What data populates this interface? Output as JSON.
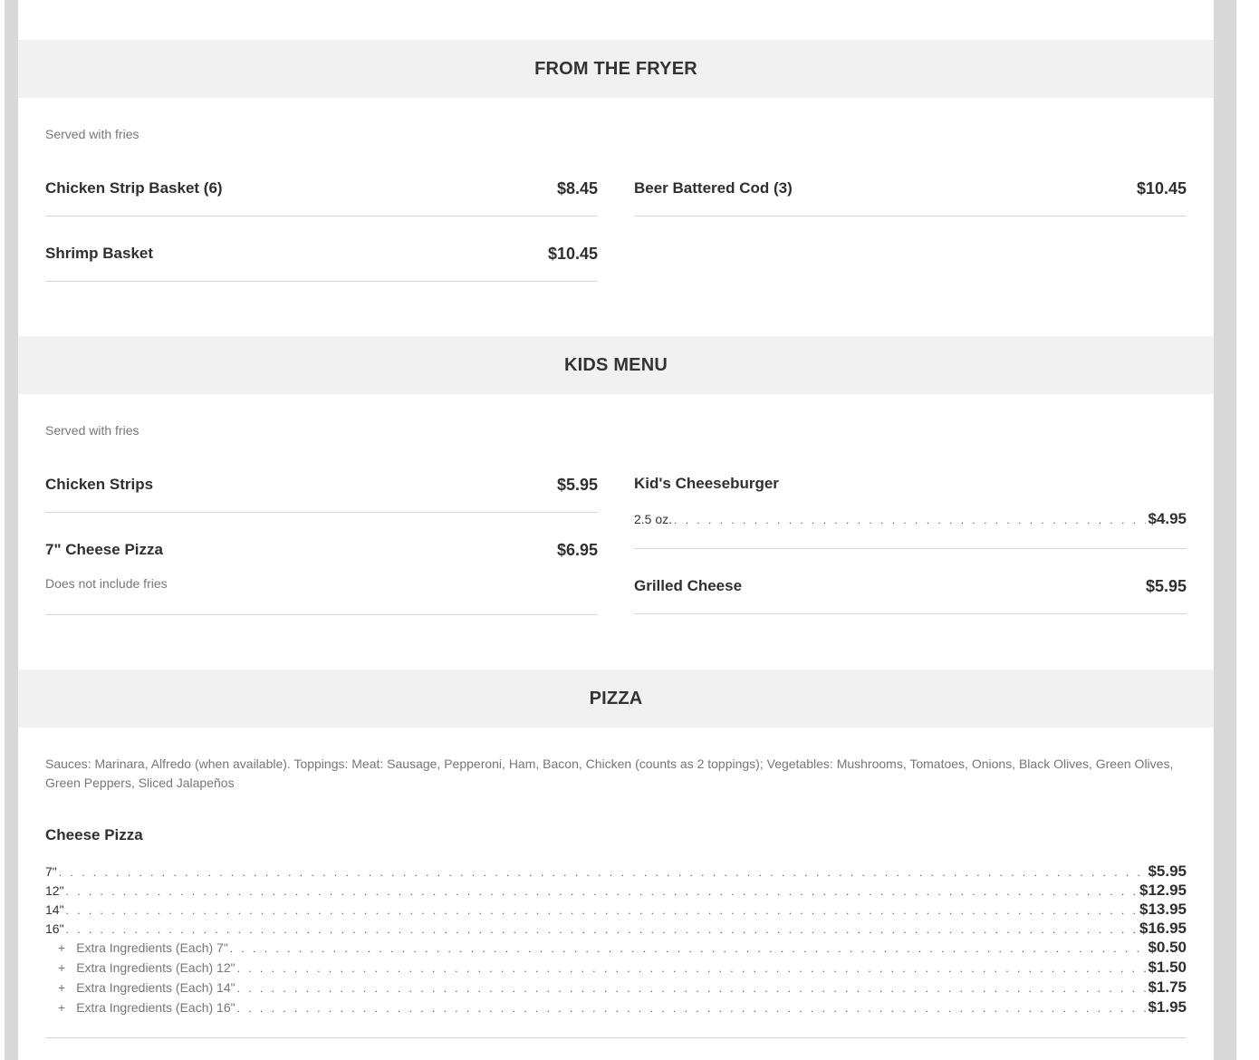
{
  "sections": {
    "fryer": {
      "title": "FROM THE FRYER",
      "note": "Served with fries",
      "items": [
        {
          "name": "Chicken Strip Basket (6)",
          "price": "$8.45"
        },
        {
          "name": "Beer Battered Cod (3)",
          "price": "$10.45"
        },
        {
          "name": "Shrimp Basket",
          "price": "$10.45"
        }
      ]
    },
    "kids": {
      "title": "KIDS MENU",
      "note": "Served with fries",
      "items": [
        {
          "name": "Chicken Strips",
          "price": "$5.95"
        },
        {
          "name": "Kid's Cheeseburger",
          "option": "2.5 oz.",
          "price": "$4.95"
        },
        {
          "name": "7\" Cheese Pizza",
          "price": "$6.95",
          "desc": "Does not include fries"
        },
        {
          "name": "Grilled Cheese",
          "price": "$5.95"
        }
      ]
    },
    "pizza": {
      "title": "PIZZA",
      "note": "Sauces: Marinara, Alfredo (when available). Toppings: Meat: Sausage, Pepperoni, Ham, Bacon, Chicken (counts as 2 toppings); Vegetables: Mushrooms, Tomatoes, Onions, Black Olives, Green Olives, Green Peppers, Sliced Jalapeños",
      "item_name": "Cheese Pizza",
      "sizes": [
        {
          "label": "7\"",
          "price": "$5.95"
        },
        {
          "label": "12\"",
          "price": "$12.95"
        },
        {
          "label": "14\"",
          "price": "$13.95"
        },
        {
          "label": "16\"",
          "price": "$16.95"
        }
      ],
      "extras": [
        {
          "label": "Extra Ingredients (Each) 7\"",
          "price": "$0.50"
        },
        {
          "label": "Extra Ingredients (Each) 12\"",
          "price": "$1.50"
        },
        {
          "label": "Extra Ingredients (Each) 14\"",
          "price": "$1.75"
        },
        {
          "label": "Extra Ingredients (Each) 16\"",
          "price": "$1.95"
        }
      ],
      "plus_symbol": "+"
    }
  }
}
